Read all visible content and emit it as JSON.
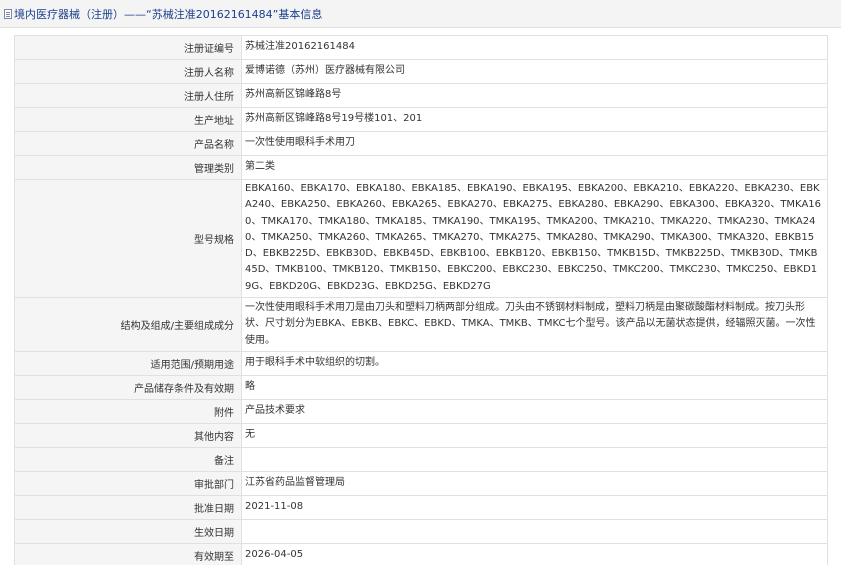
{
  "header": {
    "icon": "document-icon",
    "title": "境内医疗器械（注册）——“苏械注准20162161484”基本信息"
  },
  "rows": {
    "reg_no": {
      "label": "注册证编号",
      "value": "苏械注准20162161484"
    },
    "registrant": {
      "label": "注册人名称",
      "value": "爱博诺德（苏州）医疗器械有限公司"
    },
    "registrant_address": {
      "label": "注册人住所",
      "value": "苏州高新区锦峰路8号"
    },
    "production_address": {
      "label": "生产地址",
      "value": "苏州高新区锦峰路8号19号楼101、201"
    },
    "product_name": {
      "label": "产品名称",
      "value": "一次性使用眼科手术用刀"
    },
    "category": {
      "label": "管理类别",
      "value": "第二类"
    },
    "models": {
      "label": "型号规格",
      "value": "EBKA160、EBKA170、EBKA180、EBKA185、EBKA190、EBKA195、EBKA200、EBKA210、EBKA220、EBKA230、EBKA240、EBKA250、EBKA260、EBKA265、EBKA270、EBKA275、EBKA280、EBKA290、EBKA300、EBKA320、TMKA160、TMKA170、TMKA180、TMKA185、TMKA190、TMKA195、TMKA200、TMKA210、TMKA220、TMKA230、TMKA240、TMKA250、TMKA260、TMKA265、TMKA270、TMKA275、TMKA280、TMKA290、TMKA300、TMKA320、EBKB15D、EBKB225D、EBKB30D、EBKB45D、EBKB100、EBKB120、EBKB150、TMKB15D、TMKB225D、TMKB30D、TMKB45D、TMKB100、TMKB120、TMKB150、EBKC200、EBKC230、EBKC250、TMKC200、TMKC230、TMKC250、EBKD19G、EBKD20G、EBKD23G、EBKD25G、EBKD27G"
    },
    "structure": {
      "label": "结构及组成/主要组成成分",
      "value": "一次性使用眼科手术用刀是由刀头和塑料刀柄两部分组成。刀头由不锈钢材料制成，塑料刀柄是由聚碳酸酯材料制成。按刀头形状、尺寸划分为EBKA、EBKB、EBKC、EBKD、TMKA、TMKB、TMKC七个型号。该产品以无菌状态提供，经辐照灭菌。一次性使用。"
    },
    "scope": {
      "label": "适用范围/预期用途",
      "value": "用于眼科手术中软组织的切割。"
    },
    "storage": {
      "label": "产品储存条件及有效期",
      "value": "略"
    },
    "attachment": {
      "label": "附件",
      "value": "产品技术要求"
    },
    "other": {
      "label": "其他内容",
      "value": "无"
    },
    "remark": {
      "label": "备注",
      "value": ""
    },
    "approval_dept": {
      "label": "审批部门",
      "value": "江苏省药品监督管理局"
    },
    "approval_date": {
      "label": "批准日期",
      "value": "2021-11-08"
    },
    "effective_date": {
      "label": "生效日期",
      "value": ""
    },
    "expiry_date": {
      "label": "有效期至",
      "value": "2026-04-05"
    }
  }
}
